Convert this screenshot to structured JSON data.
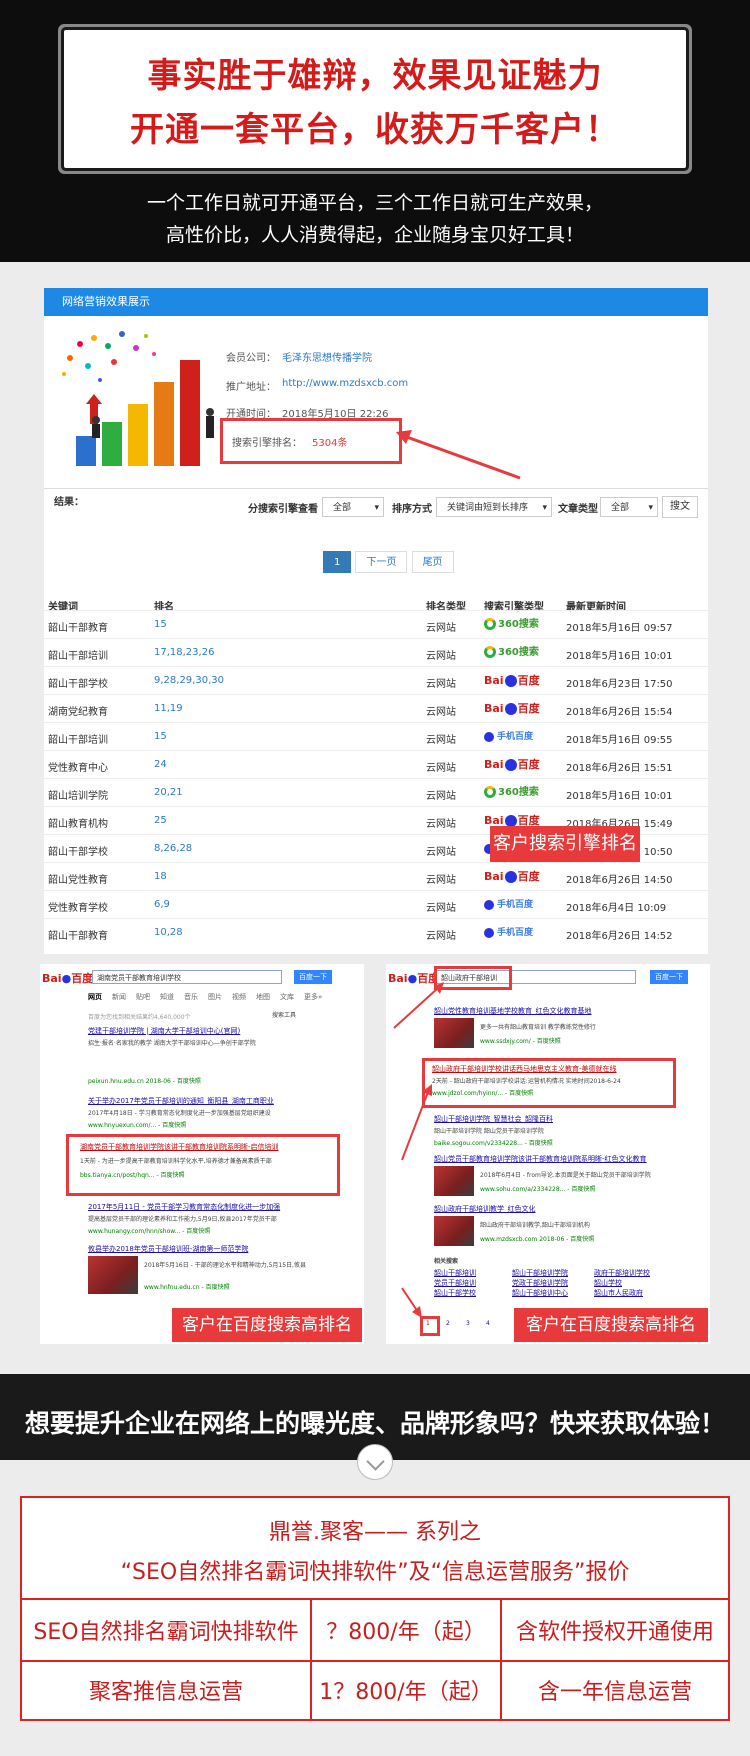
{
  "hero": {
    "title_line1": "事实胜于雄辩，效果见证魅力",
    "title_line2": "开通一套平台，收获万千客户！",
    "sub_line1": "一个工作日就可开通平台，三个工作日就可生产效果，",
    "sub_line2": "高性价比，人人消费得起，企业随身宝贝好工具！"
  },
  "panel": {
    "header": "网络营销效果展示",
    "member_label": "会员公司：",
    "member_value": "毛泽东思想传播学院",
    "promo_label": "推广地址：",
    "promo_value": "http://www.mzdsxcb.com",
    "open_label": "开通时间：",
    "open_value": "2018年5月10日 22:26",
    "rank_label": "搜索引擎排名：",
    "rank_value": "5304条"
  },
  "toolbar": {
    "result_label": "结果：",
    "engine_label": "分搜索引擎查看",
    "engine_value": "全部",
    "sort_label": "排序方式",
    "sort_value": "关键词由短到长排序",
    "type_label": "文章类型",
    "type_value": "全部",
    "search_button": "搜文"
  },
  "pager": {
    "current": "1",
    "next": "下一页",
    "last": "尾页"
  },
  "table": {
    "headers": [
      "关键词",
      "排名",
      "排名类型",
      "搜索引擎类型",
      "最新更新时间"
    ],
    "rows": [
      {
        "kw": "韶山干部教育",
        "rank": "15",
        "type": "云网站",
        "engine": "360",
        "engine_text": "360搜索",
        "time": "2018年5月16日 09:57"
      },
      {
        "kw": "韶山干部培训",
        "rank": "17,18,23,26",
        "type": "云网站",
        "engine": "360",
        "engine_text": "360搜索",
        "time": "2018年5月16日 10:01"
      },
      {
        "kw": "韶山干部学校",
        "rank": "9,28,29,30,30",
        "type": "云网站",
        "engine": "baidu",
        "engine_text": "百度",
        "time": "2018年6月23日 17:50"
      },
      {
        "kw": "湖南党纪教育",
        "rank": "11,19",
        "type": "云网站",
        "engine": "baidu",
        "engine_text": "百度",
        "time": "2018年6月26日 15:54"
      },
      {
        "kw": "韶山干部培训",
        "rank": "15",
        "type": "云网站",
        "engine": "mobile",
        "engine_text": "手机百度",
        "time": "2018年5月16日 09:55"
      },
      {
        "kw": "党性教育中心",
        "rank": "24",
        "type": "云网站",
        "engine": "baidu",
        "engine_text": "百度",
        "time": "2018年6月26日 15:51"
      },
      {
        "kw": "韶山培训学院",
        "rank": "20,21",
        "type": "云网站",
        "engine": "360",
        "engine_text": "360搜索",
        "time": "2018年5月16日 10:01"
      },
      {
        "kw": "韶山教育机构",
        "rank": "25",
        "type": "云网站",
        "engine": "baidu",
        "engine_text": "百度",
        "time": "2018年6月26日 15:49"
      },
      {
        "kw": "韶山干部学校",
        "rank": "8,26,28",
        "type": "云网站",
        "engine": "mobile",
        "engine_text": "手机百度",
        "time": "2018年5月18日 10:50"
      },
      {
        "kw": "韶山党性教育",
        "rank": "18",
        "type": "云网站",
        "engine": "baidu",
        "engine_text": "百度",
        "time": "2018年6月26日 14:50"
      },
      {
        "kw": "党性教育学校",
        "rank": "6,9",
        "type": "云网站",
        "engine": "mobile",
        "engine_text": "手机百度",
        "time": "2018年6月4日 10:09"
      },
      {
        "kw": "韶山干部教育",
        "rank": "10,28",
        "type": "云网站",
        "engine": "mobile",
        "engine_text": "手机百度",
        "time": "2018年6月26日 14:52"
      }
    ]
  },
  "tags": {
    "engine_rank": "客户搜索引擎排名",
    "baidu_left": "客户在百度搜索高排名",
    "baidu_right": "客户在百度搜索高排名"
  },
  "shot_left": {
    "query": "湖南党员干部教育培训学校",
    "button": "百度一下",
    "nav": [
      "网页",
      "新闻",
      "贴吧",
      "知道",
      "音乐",
      "图片",
      "视频",
      "地图",
      "文库",
      "更多»"
    ],
    "tools": "搜索工具",
    "count": "百度为您找到相关结果约4,640,000个",
    "results": [
      {
        "title": "党建干部培训学院 | 湖南大学干部培训中心(官网)",
        "text": "招生·报名·名家我的教学 湖南大学干部培训中心—争创干部学院",
        "url": "peixun.hnu.edu.cn  2018-06 - 百度快照"
      },
      {
        "title": "关于举办2017年党员干部培训的通知_衡阳县_湖南工商职业",
        "text": "2017年4月18日 - 学习教育常态化制度化进一步加强基层党组织建设",
        "url": "www.hnyuexun.com/...  - 百度快照"
      },
      {
        "title": "湖南党员干部教育培训学院该讲干部教育培训院系明晰-启信培训",
        "text": "1天前 - 为进一步提高干部教育培训科学化水平,培养德才兼备高素质干部",
        "url": "bbs.tianya.cn/post/hqn...  - 百度快照"
      },
      {
        "title": "2017年5月11日 - 党员干部学习教育常态化制度化进一步加强",
        "text": "提高基层党员干部的理论素养和工作能力,5月9日,攸县2017年党员干部",
        "url": "www.hunangy.com/hnn/show...  - 百度快照"
      },
      {
        "title": "攸县举办2018年党员干部培训班-湖南第一师范学院",
        "text": "2018年5月16日 - 干部的理论水平和精神动力,5月15日,攸县",
        "url": "www.hnfnu.edu.cn  - 百度快照"
      }
    ]
  },
  "shot_right": {
    "query": "韶山政府干部培训",
    "button": "百度一下",
    "results": [
      {
        "title": "韶山党性教育培训基地学校教育_红色文化教育基地",
        "text": "更多一共有韶山教育培训 教学教练党性修行",
        "url": "www.ssdxjy.com/  - 百度快照"
      },
      {
        "title": "韶山政府干部培训学校讲话西马地思克主义教育-美德就在线",
        "text": "2天前 - 韶山政府干部培训学校讲话:运营机构情况 实地时间2018-6-24",
        "url": "www.jdzol.com/hyinn/...  - 百度快照"
      },
      {
        "title": "韶山干部培训学院_智慧社会_韶隆百科",
        "text": "韶山干部培训学院 韶山党员干部培训学院",
        "url": "baike.sogou.com/v2334228...  - 百度快照"
      },
      {
        "title": "韶山党员干部教育培训学院该讲干部教育培训院系明晰-红色文化教育",
        "text": "2018年6月4日 - from导论.本页面是关于韶山党员干部培训学院",
        "url": "www.sohu.com/a/2334228...  - 百度快照"
      },
      {
        "title": "韶山政府干部培训教学_红色文化",
        "text": "韶山政府干部培训教学,韶山干部培训机构",
        "url": "www.mzdsxcb.com  2018-06  - 百度快照"
      }
    ],
    "related_title": "相关搜索",
    "related": [
      "韶山干部培训",
      "韶山干部培训学院",
      "政府干部培训学校",
      "党员干部培训",
      "党政干部培训学院",
      "韶山学校",
      "韶山干部学校",
      "韶山干部培训中心",
      "韶山市人民政府"
    ],
    "pages": [
      "1",
      "2",
      "3",
      "4"
    ]
  },
  "banner2": {
    "text": "想要提升企业在网络上的曝光度、品牌形象吗？快来获取体验！"
  },
  "price": {
    "title1": "鼎誉.聚客—— 系列之",
    "title2": "“SEO自然排名霸词快排软件”及“信息运营服务”报价",
    "rows": [
      {
        "name": "SEO自然排名霸词快排软件",
        "price": "？800/年（起）",
        "note": "含软件授权开通使用"
      },
      {
        "name": "聚客推信息运营",
        "price": "1？800/年（起）",
        "note": "含一年信息运营"
      }
    ]
  }
}
